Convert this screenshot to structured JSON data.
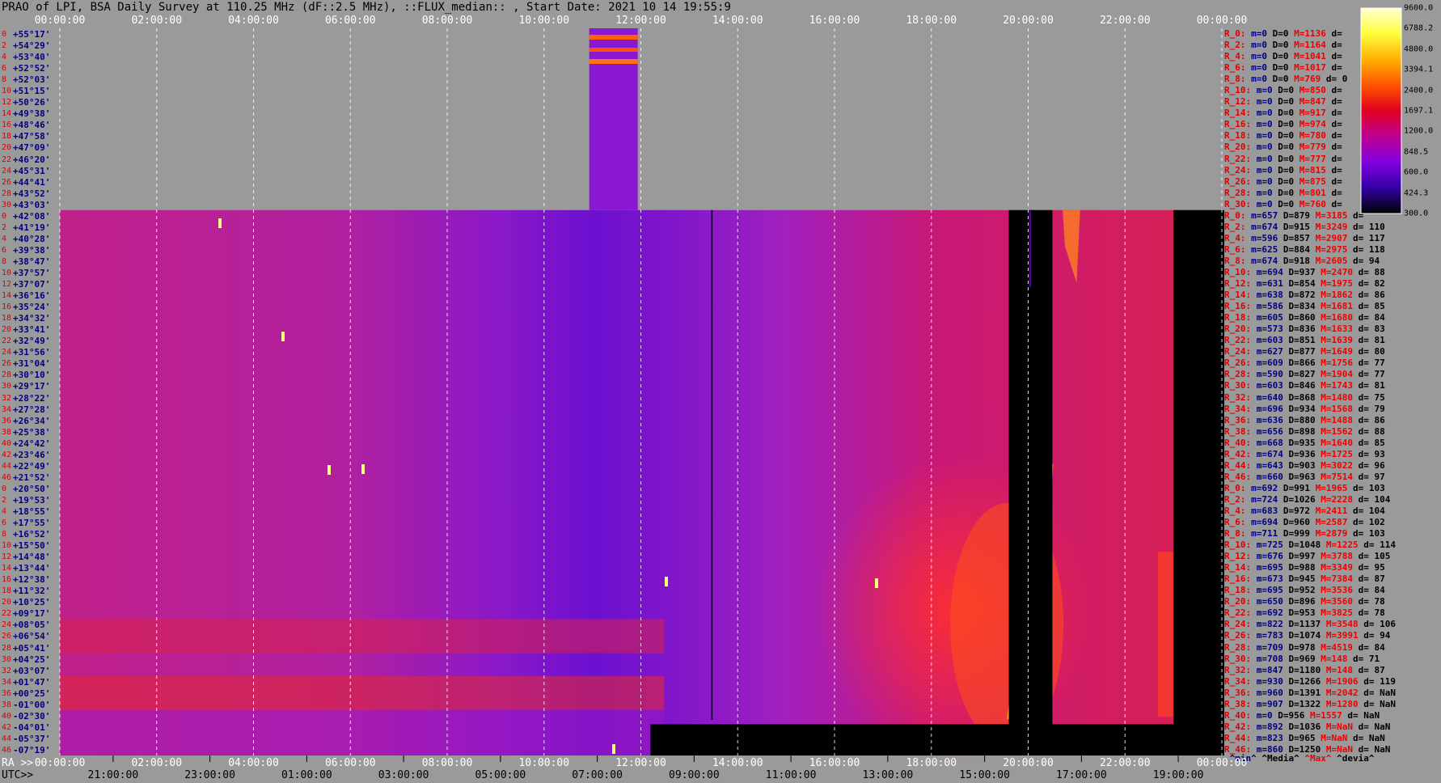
{
  "title": "PRAO of LPI, BSA Daily Survey at 110.25 MHz (dF::2.5 MHz), ::FLUX_median:: , Start Date: 2021 10 14 19:55:9",
  "chart_data": {
    "type": "heatmap",
    "top_axis_ticks": [
      "00:00:00",
      "02:00:00",
      "04:00:00",
      "06:00:00",
      "08:00:00",
      "10:00:00",
      "12:00:00",
      "14:00:00",
      "16:00:00",
      "18:00:00",
      "20:00:00",
      "22:00:00",
      "00:00:00"
    ],
    "ra_label": "RA >>",
    "ra_ticks": [
      "00:00:00",
      "02:00:00",
      "04:00:00",
      "06:00:00",
      "08:00:00",
      "10:00:00",
      "12:00:00",
      "14:00:00",
      "16:00:00",
      "18:00:00",
      "20:00:00",
      "22:00:00",
      "00:00:00"
    ],
    "utc_label": "UTC>>",
    "utc_ticks": [
      "21:00:00",
      "23:00:00",
      "01:00:00",
      "03:00:00",
      "05:00:00",
      "07:00:00",
      "09:00:00",
      "11:00:00",
      "13:00:00",
      "15:00:00",
      "17:00:00",
      "19:00:00"
    ],
    "colorbar": {
      "labels": [
        "9600.0",
        "6788.2",
        "4800.0",
        "3394.1",
        "2400.0",
        "1697.1",
        "1200.0",
        "848.5",
        "600.0",
        "424.3",
        "300.0"
      ],
      "colors": [
        "#ffffc0",
        "#ffff40",
        "#ffd000",
        "#ff9000",
        "#ff4000",
        "#e00020",
        "#d00090",
        "#9000e0",
        "#6000d0",
        "#200040",
        "#000000"
      ]
    },
    "rows": [
      {
        "i": "0",
        "lat": "+55°17'"
      },
      {
        "i": "2",
        "lat": "+54°29'"
      },
      {
        "i": "4",
        "lat": "+53°40'"
      },
      {
        "i": "6",
        "lat": "+52°52'"
      },
      {
        "i": "8",
        "lat": "+52°03'"
      },
      {
        "i": "10",
        "lat": "+51°15'"
      },
      {
        "i": "12",
        "lat": "+50°26'"
      },
      {
        "i": "14",
        "lat": "+49°38'"
      },
      {
        "i": "16",
        "lat": "+48°46'"
      },
      {
        "i": "18",
        "lat": "+47°58'"
      },
      {
        "i": "20",
        "lat": "+47°09'"
      },
      {
        "i": "22",
        "lat": "+46°20'"
      },
      {
        "i": "24",
        "lat": "+45°31'"
      },
      {
        "i": "26",
        "lat": "+44°41'"
      },
      {
        "i": "28",
        "lat": "+43°52'"
      },
      {
        "i": "30",
        "lat": "+43°03'"
      },
      {
        "i": "0",
        "lat": "+42°08'"
      },
      {
        "i": "2",
        "lat": "+41°19'"
      },
      {
        "i": "4",
        "lat": "+40°28'"
      },
      {
        "i": "6",
        "lat": "+39°38'"
      },
      {
        "i": "8",
        "lat": "+38°47'"
      },
      {
        "i": "10",
        "lat": "+37°57'"
      },
      {
        "i": "12",
        "lat": "+37°07'"
      },
      {
        "i": "14",
        "lat": "+36°16'"
      },
      {
        "i": "16",
        "lat": "+35°24'"
      },
      {
        "i": "18",
        "lat": "+34°32'"
      },
      {
        "i": "20",
        "lat": "+33°41'"
      },
      {
        "i": "22",
        "lat": "+32°49'"
      },
      {
        "i": "24",
        "lat": "+31°56'"
      },
      {
        "i": "26",
        "lat": "+31°04'"
      },
      {
        "i": "28",
        "lat": "+30°10'"
      },
      {
        "i": "30",
        "lat": "+29°17'"
      },
      {
        "i": "32",
        "lat": "+28°22'"
      },
      {
        "i": "34",
        "lat": "+27°28'"
      },
      {
        "i": "36",
        "lat": "+26°34'"
      },
      {
        "i": "38",
        "lat": "+25°38'"
      },
      {
        "i": "40",
        "lat": "+24°42'"
      },
      {
        "i": "42",
        "lat": "+23°46'"
      },
      {
        "i": "44",
        "lat": "+22°49'"
      },
      {
        "i": "46",
        "lat": "+21°52'"
      },
      {
        "i": "0",
        "lat": "+20°50'"
      },
      {
        "i": "2",
        "lat": "+19°53'"
      },
      {
        "i": "4",
        "lat": "+18°55'"
      },
      {
        "i": "6",
        "lat": "+17°55'"
      },
      {
        "i": "8",
        "lat": "+16°52'"
      },
      {
        "i": "10",
        "lat": "+15°50'"
      },
      {
        "i": "12",
        "lat": "+14°48'"
      },
      {
        "i": "14",
        "lat": "+13°44'"
      },
      {
        "i": "16",
        "lat": "+12°38'"
      },
      {
        "i": "18",
        "lat": "+11°32'"
      },
      {
        "i": "20",
        "lat": "+10°25'"
      },
      {
        "i": "22",
        "lat": "+09°17'"
      },
      {
        "i": "24",
        "lat": "+08°05'"
      },
      {
        "i": "26",
        "lat": "+06°54'"
      },
      {
        "i": "28",
        "lat": "+05°41'"
      },
      {
        "i": "30",
        "lat": "+04°25'"
      },
      {
        "i": "32",
        "lat": "+03°07'"
      },
      {
        "i": "34",
        "lat": "+01°47'"
      },
      {
        "i": "36",
        "lat": "+00°25'"
      },
      {
        "i": "38",
        "lat": "-01°00'"
      },
      {
        "i": "40",
        "lat": "-02°30'"
      },
      {
        "i": "42",
        "lat": "-04°01'"
      },
      {
        "i": "44",
        "lat": "-05°37'"
      },
      {
        "i": "46",
        "lat": "-07°19'"
      }
    ],
    "stats": [
      {
        "r": "R_0:",
        "m": "m=0",
        "d": "D=0",
        "M": "M=1136",
        "dev": "d="
      },
      {
        "r": "R_2:",
        "m": "m=0",
        "d": "D=0",
        "M": "M=1164",
        "dev": "d="
      },
      {
        "r": "R_4:",
        "m": "m=0",
        "d": "D=0",
        "M": "M=1041",
        "dev": "d="
      },
      {
        "r": "R_6:",
        "m": "m=0",
        "d": "D=0",
        "M": "M=1017",
        "dev": "d="
      },
      {
        "r": "R_8:",
        "m": "m=0",
        "d": "D=0",
        "M": "M=769",
        "dev": "d= 0"
      },
      {
        "r": "R_10:",
        "m": "m=0",
        "d": "D=0",
        "M": "M=850",
        "dev": "d="
      },
      {
        "r": "R_12:",
        "m": "m=0",
        "d": "D=0",
        "M": "M=847",
        "dev": "d="
      },
      {
        "r": "R_14:",
        "m": "m=0",
        "d": "D=0",
        "M": "M=917",
        "dev": "d="
      },
      {
        "r": "R_16:",
        "m": "m=0",
        "d": "D=0",
        "M": "M=974",
        "dev": "d="
      },
      {
        "r": "R_18:",
        "m": "m=0",
        "d": "D=0",
        "M": "M=780",
        "dev": "d="
      },
      {
        "r": "R_20:",
        "m": "m=0",
        "d": "D=0",
        "M": "M=779",
        "dev": "d="
      },
      {
        "r": "R_22:",
        "m": "m=0",
        "d": "D=0",
        "M": "M=777",
        "dev": "d="
      },
      {
        "r": "R_24:",
        "m": "m=0",
        "d": "D=0",
        "M": "M=815",
        "dev": "d="
      },
      {
        "r": "R_26:",
        "m": "m=0",
        "d": "D=0",
        "M": "M=875",
        "dev": "d="
      },
      {
        "r": "R_28:",
        "m": "m=0",
        "d": "D=0",
        "M": "M=801",
        "dev": "d="
      },
      {
        "r": "R_30:",
        "m": "m=0",
        "d": "D=0",
        "M": "M=760",
        "dev": "d="
      },
      {
        "r": "R_0:",
        "m": "m=657",
        "d": "D=879",
        "M": "M=3185",
        "dev": "d="
      },
      {
        "r": "R_2:",
        "m": "m=674",
        "d": "D=915",
        "M": "M=3249",
        "dev": "d= 110"
      },
      {
        "r": "R_4:",
        "m": "m=596",
        "d": "D=857",
        "M": "M=2907",
        "dev": "d= 117"
      },
      {
        "r": "R_6:",
        "m": "m=625",
        "d": "D=884",
        "M": "M=2975",
        "dev": "d= 118"
      },
      {
        "r": "R_8:",
        "m": "m=674",
        "d": "D=918",
        "M": "M=2605",
        "dev": "d= 94"
      },
      {
        "r": "R_10:",
        "m": "m=694",
        "d": "D=937",
        "M": "M=2470",
        "dev": "d= 88"
      },
      {
        "r": "R_12:",
        "m": "m=631",
        "d": "D=854",
        "M": "M=1975",
        "dev": "d= 82"
      },
      {
        "r": "R_14:",
        "m": "m=638",
        "d": "D=872",
        "M": "M=1862",
        "dev": "d= 86"
      },
      {
        "r": "R_16:",
        "m": "m=586",
        "d": "D=834",
        "M": "M=1681",
        "dev": "d= 85"
      },
      {
        "r": "R_18:",
        "m": "m=605",
        "d": "D=860",
        "M": "M=1680",
        "dev": "d= 84"
      },
      {
        "r": "R_20:",
        "m": "m=573",
        "d": "D=836",
        "M": "M=1633",
        "dev": "d= 83"
      },
      {
        "r": "R_22:",
        "m": "m=603",
        "d": "D=851",
        "M": "M=1639",
        "dev": "d= 81"
      },
      {
        "r": "R_24:",
        "m": "m=627",
        "d": "D=877",
        "M": "M=1649",
        "dev": "d= 80"
      },
      {
        "r": "R_26:",
        "m": "m=609",
        "d": "D=866",
        "M": "M=1756",
        "dev": "d= 77"
      },
      {
        "r": "R_28:",
        "m": "m=590",
        "d": "D=827",
        "M": "M=1904",
        "dev": "d= 77"
      },
      {
        "r": "R_30:",
        "m": "m=603",
        "d": "D=846",
        "M": "M=1743",
        "dev": "d= 81"
      },
      {
        "r": "R_32:",
        "m": "m=640",
        "d": "D=868",
        "M": "M=1480",
        "dev": "d= 75"
      },
      {
        "r": "R_34:",
        "m": "m=696",
        "d": "D=934",
        "M": "M=1568",
        "dev": "d= 79"
      },
      {
        "r": "R_36:",
        "m": "m=636",
        "d": "D=880",
        "M": "M=1488",
        "dev": "d= 86"
      },
      {
        "r": "R_38:",
        "m": "m=656",
        "d": "D=898",
        "M": "M=1562",
        "dev": "d= 88"
      },
      {
        "r": "R_40:",
        "m": "m=668",
        "d": "D=935",
        "M": "M=1640",
        "dev": "d= 85"
      },
      {
        "r": "R_42:",
        "m": "m=674",
        "d": "D=936",
        "M": "M=1725",
        "dev": "d= 93"
      },
      {
        "r": "R_44:",
        "m": "m=643",
        "d": "D=903",
        "M": "M=3022",
        "dev": "d= 96"
      },
      {
        "r": "R_46:",
        "m": "m=660",
        "d": "D=963",
        "M": "M=7514",
        "dev": "d= 97"
      },
      {
        "r": "R_0:",
        "m": "m=692",
        "d": "D=991",
        "M": "M=1965",
        "dev": "d= 103"
      },
      {
        "r": "R_2:",
        "m": "m=724",
        "d": "D=1026",
        "M": "M=2228",
        "dev": "d= 104"
      },
      {
        "r": "R_4:",
        "m": "m=683",
        "d": "D=972",
        "M": "M=2411",
        "dev": "d= 104"
      },
      {
        "r": "R_6:",
        "m": "m=694",
        "d": "D=960",
        "M": "M=2587",
        "dev": "d= 102"
      },
      {
        "r": "R_8:",
        "m": "m=711",
        "d": "D=999",
        "M": "M=2879",
        "dev": "d= 103"
      },
      {
        "r": "R_10:",
        "m": "m=725",
        "d": "D=1048",
        "M": "M=1225",
        "dev": "d= 114"
      },
      {
        "r": "R_12:",
        "m": "m=676",
        "d": "D=997",
        "M": "M=3788",
        "dev": "d= 105"
      },
      {
        "r": "R_14:",
        "m": "m=695",
        "d": "D=988",
        "M": "M=3349",
        "dev": "d= 95"
      },
      {
        "r": "R_16:",
        "m": "m=673",
        "d": "D=945",
        "M": "M=7384",
        "dev": "d= 87"
      },
      {
        "r": "R_18:",
        "m": "m=695",
        "d": "D=952",
        "M": "M=3536",
        "dev": "d= 84"
      },
      {
        "r": "R_20:",
        "m": "m=650",
        "d": "D=896",
        "M": "M=3560",
        "dev": "d= 78"
      },
      {
        "r": "R_22:",
        "m": "m=692",
        "d": "D=953",
        "M": "M=3825",
        "dev": "d= 78"
      },
      {
        "r": "R_24:",
        "m": "m=822",
        "d": "D=1137",
        "M": "M=3548",
        "dev": "d= 106"
      },
      {
        "r": "R_26:",
        "m": "m=783",
        "d": "D=1074",
        "M": "M=3991",
        "dev": "d= 94"
      },
      {
        "r": "R_28:",
        "m": "m=709",
        "d": "D=978",
        "M": "M=4519",
        "dev": "d= 84"
      },
      {
        "r": "R_30:",
        "m": "m=708",
        "d": "D=969",
        "M": "M=148",
        "dev": "d= 71"
      },
      {
        "r": "R_32:",
        "m": "m=847",
        "d": "D=1180",
        "M": "M=148",
        "dev": "d= 87"
      },
      {
        "r": "R_34:",
        "m": "m=930",
        "d": "D=1266",
        "M": "M=1906",
        "dev": "d= 119"
      },
      {
        "r": "R_36:",
        "m": "m=960",
        "d": "D=1391",
        "M": "M=2042",
        "dev": "d= NaN"
      },
      {
        "r": "R_38:",
        "m": "m=907",
        "d": "D=1322",
        "M": "M=1280",
        "dev": "d= NaN"
      },
      {
        "r": "R_40:",
        "m": "m=0",
        "d": "D=956",
        "M": "M=1557",
        "dev": "d= NaN"
      },
      {
        "r": "R_42:",
        "m": "m=892",
        "d": "D=1036",
        "M": "M=NaN",
        "dev": "d= NaN"
      },
      {
        "r": "R_44:",
        "m": "m=823",
        "d": "D=965",
        "M": "M=NaN",
        "dev": "d= NaN"
      },
      {
        "r": "R_46:",
        "m": "m=860",
        "d": "D=1250",
        "M": "M=NaN",
        "dev": "d= NaN"
      }
    ],
    "stats_footer": {
      "min": "^min^",
      "median": "^Media^",
      "max": "^Max^",
      "dev": "^devia^"
    }
  }
}
